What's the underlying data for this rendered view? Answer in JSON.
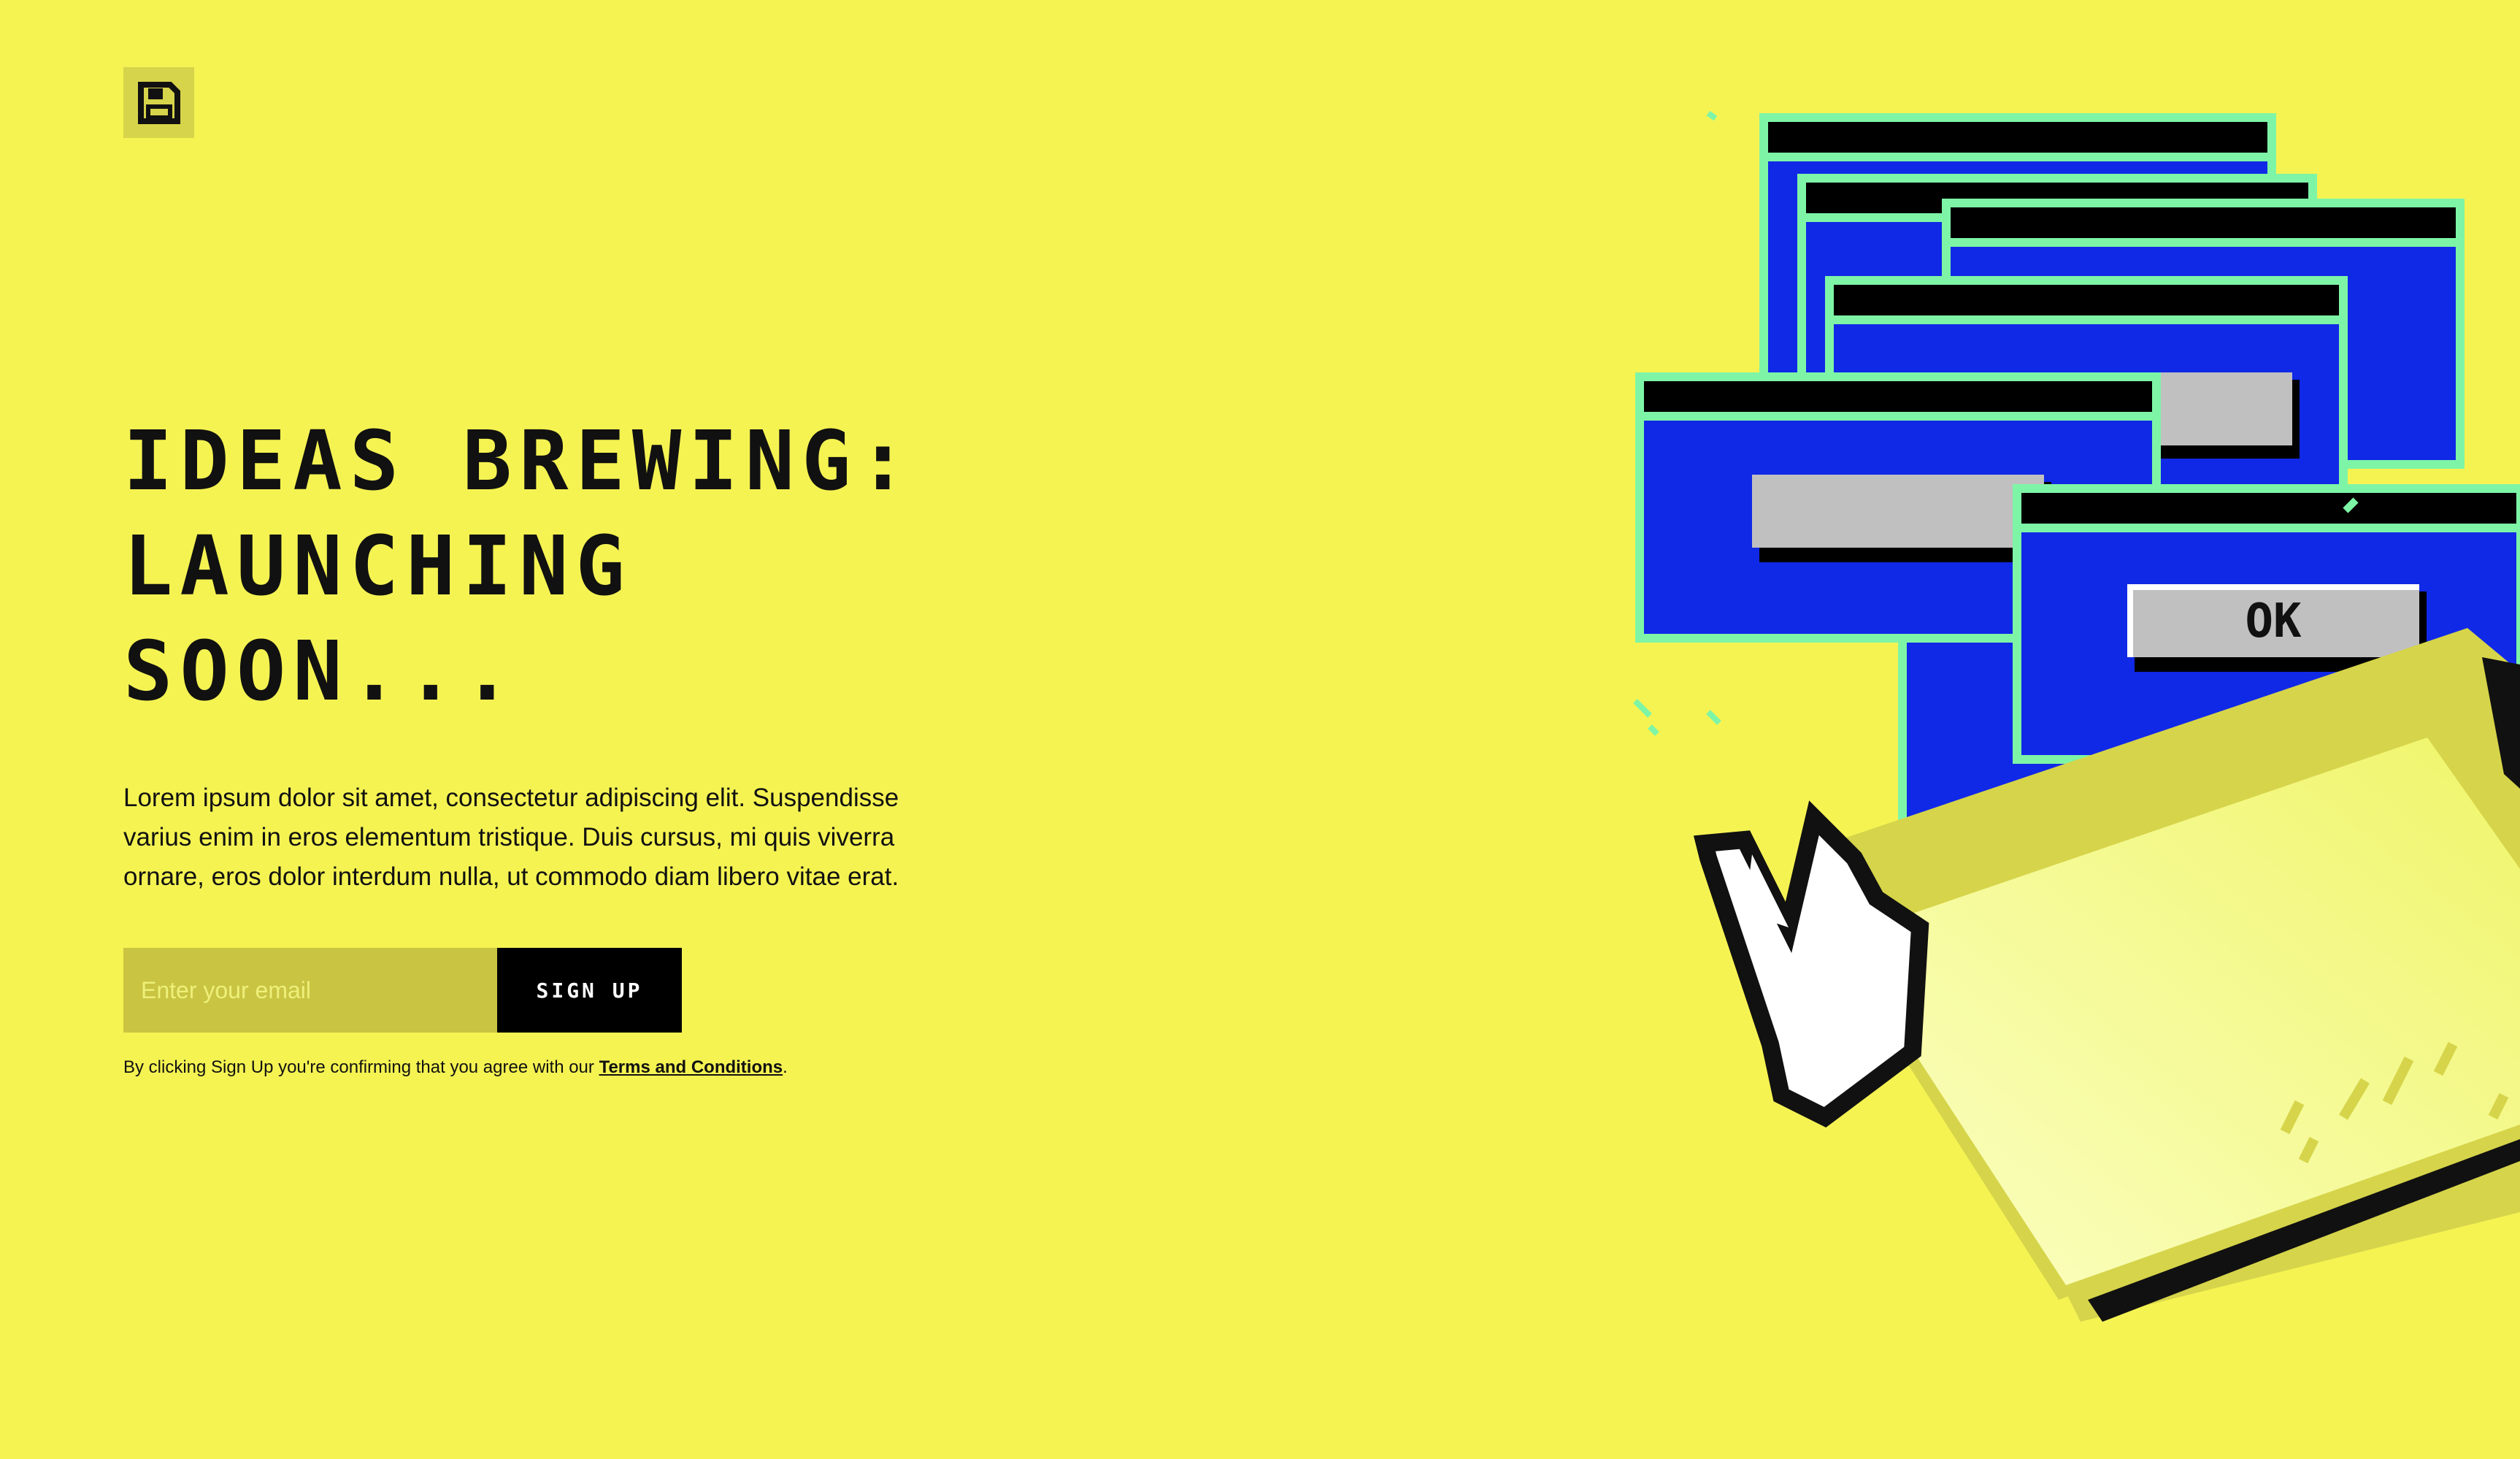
{
  "logo": {
    "icon": "floppy-disk-icon"
  },
  "hero": {
    "headline_line1": "IDEAS BREWING:",
    "headline_line2": "LAUNCHING",
    "headline_line3": "SOON...",
    "description": "Lorem ipsum dolor sit amet, consectetur adipiscing elit. Suspendisse varius enim in eros elementum tristique. Duis cursus, mi quis viverra ornare, eros dolor interdum nulla, ut commodo diam libero vitae erat."
  },
  "form": {
    "email_placeholder": "Enter your email",
    "signup_label": "SIGN UP"
  },
  "legal": {
    "prefix": "By clicking Sign Up you're confirming that you agree with our ",
    "link_text": "Terms and Conditions",
    "suffix": "."
  },
  "illustration": {
    "ok_label": "OK",
    "icons": [
      "window-stack-icon",
      "pointer-hand-icon",
      "folder-icon"
    ]
  },
  "colors": {
    "background": "#f5f352",
    "window_blue": "#1029e6",
    "window_border": "#7ef5a6",
    "button_gray": "#c0c0c0"
  }
}
